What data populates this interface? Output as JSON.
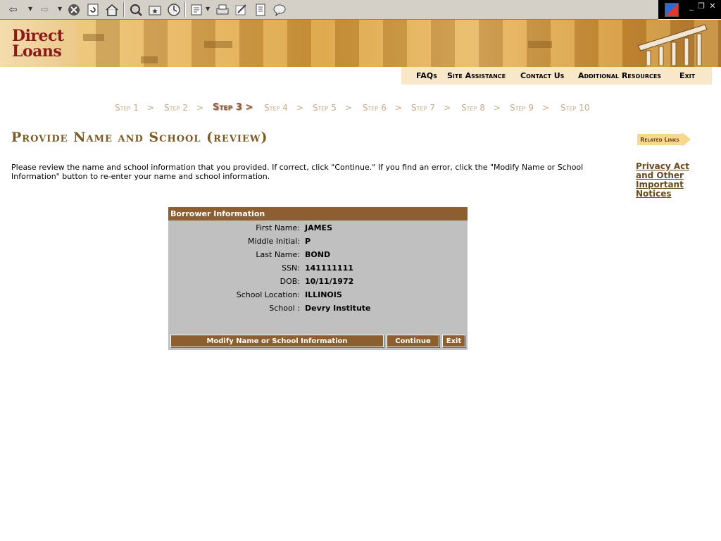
{
  "browser": {
    "icons": [
      "back-icon",
      "forward-icon",
      "stop-icon",
      "refresh-icon",
      "home-icon",
      "search-icon",
      "favorites-icon",
      "history-icon",
      "edit-icon",
      "print-icon",
      "edit-page-icon",
      "discuss-icon",
      "messenger-icon"
    ]
  },
  "banner": {
    "logo_line1": "Direct",
    "logo_line2": "Loans"
  },
  "top_nav": [
    {
      "label": "FAQs"
    },
    {
      "label": "Site Assistance"
    },
    {
      "label": "Contact Us"
    },
    {
      "label": "Additional Resources"
    },
    {
      "label": "Exit"
    }
  ],
  "steps": [
    {
      "label": "Step 1"
    },
    {
      "label": "Step 2"
    },
    {
      "label": "Step 3 >"
    },
    {
      "label": "Step 4"
    },
    {
      "label": "Step 5"
    },
    {
      "label": "Step 6"
    },
    {
      "label": "Step 7"
    },
    {
      "label": "Step 8"
    },
    {
      "label": "Step 9"
    },
    {
      "label": "Step 10"
    }
  ],
  "step_separator": ">",
  "active_step": 3,
  "page": {
    "title": "Provide Name and School (review)",
    "related_links_label": "Related Links",
    "instructions": "Please review the name and school information that you provided. If correct, click \"Continue.\" If you find an error, click the \"Modify Name or School Information\" button to re-enter your name and school information.",
    "privacy_link": "Privacy Act and Other Important Notices"
  },
  "borrower": {
    "header": "Borrower Information",
    "fields": [
      {
        "label": "First Name:",
        "value": "JAMES"
      },
      {
        "label": "Middle Initial:",
        "value": "P"
      },
      {
        "label": "Last Name:",
        "value": "BOND"
      },
      {
        "label": "SSN:",
        "value": "141111111"
      },
      {
        "label": "DOB:",
        "value": "10/11/1972"
      },
      {
        "label": "School Location:",
        "value": "ILLINOIS"
      },
      {
        "label": "School :",
        "value": "Devry Institute"
      }
    ],
    "buttons": {
      "modify": "Modify Name or School Information",
      "continue": "Continue",
      "exit": "Exit"
    }
  },
  "colors": {
    "brand_brown": "#8d5e2e",
    "title_gold": "#7a5a22",
    "logo_red": "#8b1a1a",
    "panel_gray": "#c0c0c0"
  }
}
